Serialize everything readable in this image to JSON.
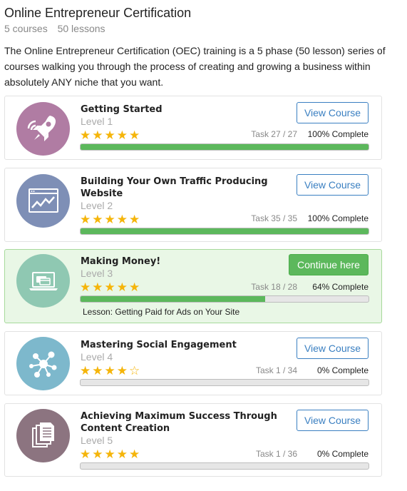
{
  "header": {
    "title": "Online Entrepreneur Certification",
    "courses": "5 courses",
    "lessons": "50 lessons",
    "description": "The Online Entrepreneur Certification (OEC) training is a 5 phase (50 lesson) series of courses walking you through the process of creating and growing a business within absolutely ANY niche that you want."
  },
  "colors": {
    "progress": "#5cb85c",
    "button_blue": "#3a7fc1",
    "active_bg": "#e9f7e6",
    "star": "#f5b50a"
  },
  "courses": [
    {
      "title": "Getting Started",
      "level": "Level 1",
      "icon": "rocket-icon",
      "icon_color": "#b07ca3",
      "rating": 5,
      "task": "Task 27 / 27",
      "complete": "100% Complete",
      "progress": 1.0,
      "button": "View Course"
    },
    {
      "title": "Building Your Own Traffic Producing Website",
      "level": "Level 2",
      "icon": "browser-chart-icon",
      "icon_color": "#7e8fb6",
      "rating": 5,
      "task": "Task 35 / 35",
      "complete": "100% Complete",
      "progress": 1.0,
      "button": "View Course"
    },
    {
      "title": "Making Money!",
      "level": "Level 3",
      "icon": "laptop-card-icon",
      "icon_color": "#8fc8b2",
      "rating": 5,
      "task": "Task 18 / 28",
      "complete": "64% Complete",
      "progress": 0.64,
      "button": "Continue here",
      "lesson": "Lesson: Getting Paid for Ads on Your Site"
    },
    {
      "title": "Mastering Social Engagement",
      "level": "Level 4",
      "icon": "social-network-icon",
      "icon_color": "#7db8cc",
      "rating": 4.5,
      "task": "Task 1 / 34",
      "complete": "0% Complete",
      "progress": 0,
      "button": "View Course"
    },
    {
      "title": "Achieving Maximum Success Through Content Creation",
      "level": "Level 5",
      "icon": "documents-icon",
      "icon_color": "#8c7480",
      "rating": 5,
      "task": "Task 1 / 36",
      "complete": "0% Complete",
      "progress": 0,
      "button": "View Course"
    }
  ]
}
